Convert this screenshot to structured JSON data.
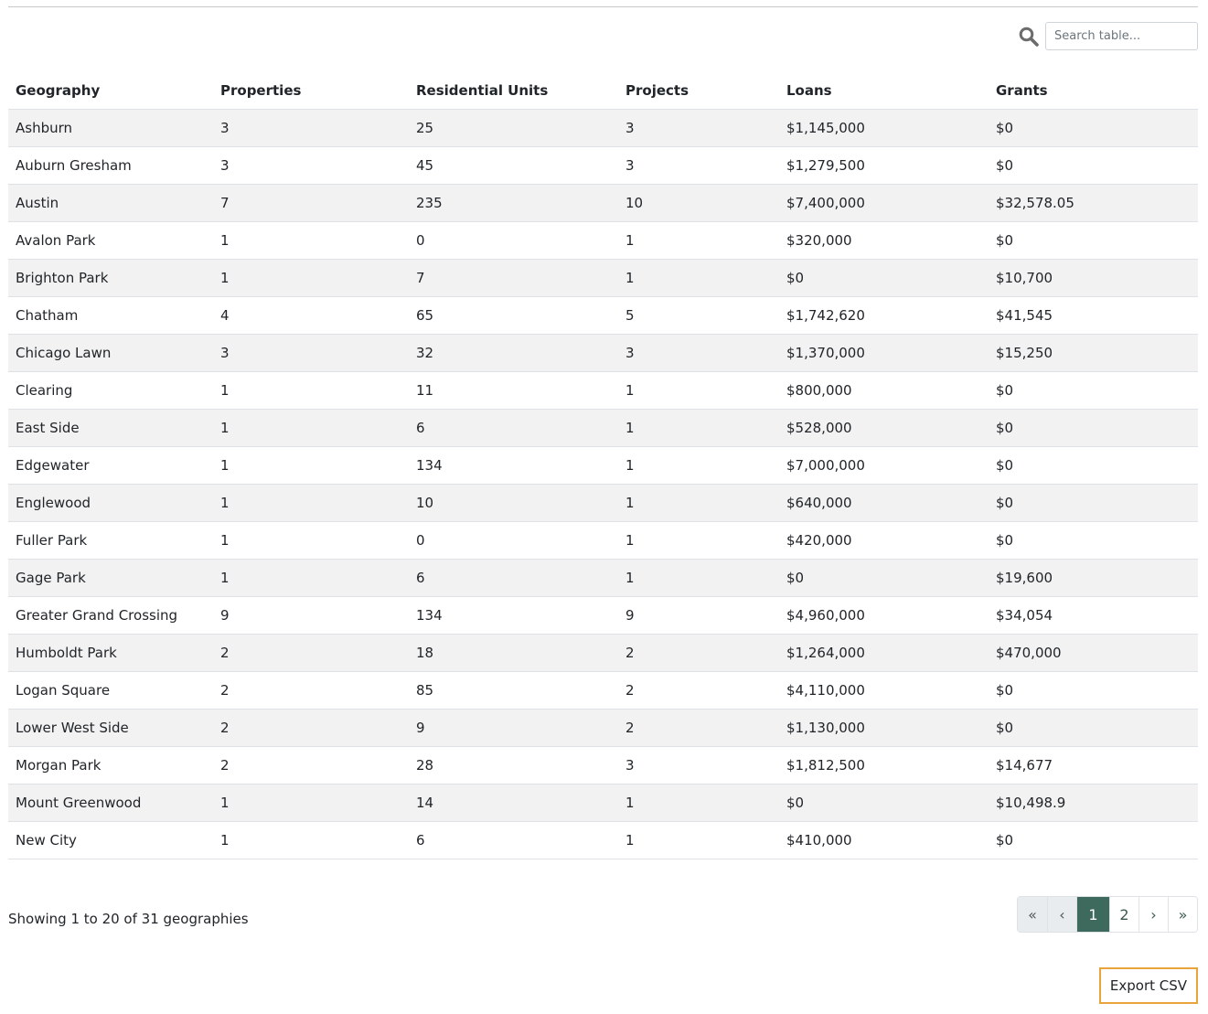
{
  "search": {
    "placeholder": "Search table..."
  },
  "table": {
    "columns": [
      "Geography",
      "Properties",
      "Residential Units",
      "Projects",
      "Loans",
      "Grants"
    ],
    "rows": [
      [
        "Ashburn",
        "3",
        "25",
        "3",
        "$1,145,000",
        "$0"
      ],
      [
        "Auburn Gresham",
        "3",
        "45",
        "3",
        "$1,279,500",
        "$0"
      ],
      [
        "Austin",
        "7",
        "235",
        "10",
        "$7,400,000",
        "$32,578.05"
      ],
      [
        "Avalon Park",
        "1",
        "0",
        "1",
        "$320,000",
        "$0"
      ],
      [
        "Brighton Park",
        "1",
        "7",
        "1",
        "$0",
        "$10,700"
      ],
      [
        "Chatham",
        "4",
        "65",
        "5",
        "$1,742,620",
        "$41,545"
      ],
      [
        "Chicago Lawn",
        "3",
        "32",
        "3",
        "$1,370,000",
        "$15,250"
      ],
      [
        "Clearing",
        "1",
        "11",
        "1",
        "$800,000",
        "$0"
      ],
      [
        "East Side",
        "1",
        "6",
        "1",
        "$528,000",
        "$0"
      ],
      [
        "Edgewater",
        "1",
        "134",
        "1",
        "$7,000,000",
        "$0"
      ],
      [
        "Englewood",
        "1",
        "10",
        "1",
        "$640,000",
        "$0"
      ],
      [
        "Fuller Park",
        "1",
        "0",
        "1",
        "$420,000",
        "$0"
      ],
      [
        "Gage Park",
        "1",
        "6",
        "1",
        "$0",
        "$19,600"
      ],
      [
        "Greater Grand Crossing",
        "9",
        "134",
        "9",
        "$4,960,000",
        "$34,054"
      ],
      [
        "Humboldt Park",
        "2",
        "18",
        "2",
        "$1,264,000",
        "$470,000"
      ],
      [
        "Logan Square",
        "2",
        "85",
        "2",
        "$4,110,000",
        "$0"
      ],
      [
        "Lower West Side",
        "2",
        "9",
        "2",
        "$1,130,000",
        "$0"
      ],
      [
        "Morgan Park",
        "2",
        "28",
        "3",
        "$1,812,500",
        "$14,677"
      ],
      [
        "Mount Greenwood",
        "1",
        "14",
        "1",
        "$0",
        "$10,498.9"
      ],
      [
        "New City",
        "1",
        "6",
        "1",
        "$410,000",
        "$0"
      ]
    ]
  },
  "footer": {
    "showing": "Showing 1 to 20 of 31 geographies"
  },
  "pagination": {
    "first": "«",
    "prev": "‹",
    "pages": [
      "1",
      "2"
    ],
    "current_page": "1",
    "next": "›",
    "last": "»"
  },
  "export": {
    "label": "Export CSV"
  },
  "colors": {
    "accent": "#3d6a5c",
    "export_border": "#e8a33b",
    "row_stripe": "#f2f2f2"
  }
}
